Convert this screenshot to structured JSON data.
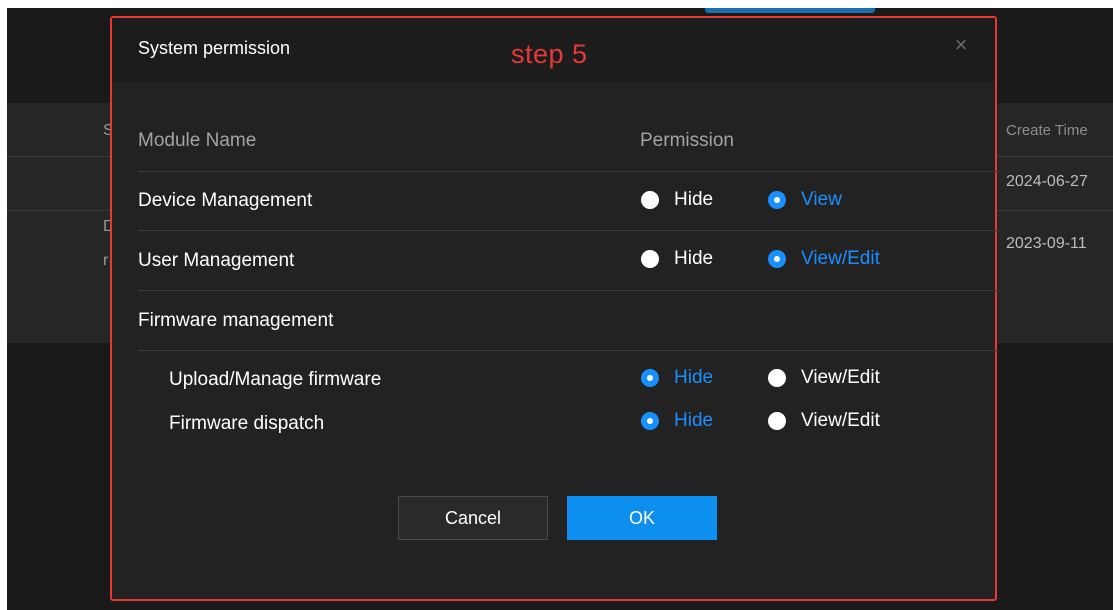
{
  "background": {
    "column_header_create_time": "Create Time",
    "row_dates": [
      "2024-06-27",
      "2023-09-11"
    ],
    "edge_glyphs": [
      "S",
      "D",
      "r"
    ]
  },
  "dialog": {
    "title": "System permission",
    "annotation": "step 5",
    "close_icon": "×",
    "columns": {
      "module_name": "Module Name",
      "permission": "Permission"
    },
    "rows": [
      {
        "label": "Device Management",
        "options": [
          {
            "label": "Hide",
            "checked": false
          },
          {
            "label": "View",
            "checked": true
          }
        ]
      },
      {
        "label": "User Management",
        "options": [
          {
            "label": "Hide",
            "checked": false
          },
          {
            "label": "View/Edit",
            "checked": true
          }
        ]
      },
      {
        "label": "Firmware management",
        "options": []
      },
      {
        "label": "Upload/Manage firmware",
        "options": [
          {
            "label": "Hide",
            "checked": true
          },
          {
            "label": "View/Edit",
            "checked": false
          }
        ]
      },
      {
        "label": "Firmware dispatch",
        "options": [
          {
            "label": "Hide",
            "checked": true
          },
          {
            "label": "View/Edit",
            "checked": false
          }
        ]
      }
    ],
    "buttons": {
      "cancel": "Cancel",
      "ok": "OK"
    }
  },
  "colors": {
    "accent": "#1890ff",
    "annotation_red": "#e53935",
    "dialog_bg": "#222222"
  }
}
